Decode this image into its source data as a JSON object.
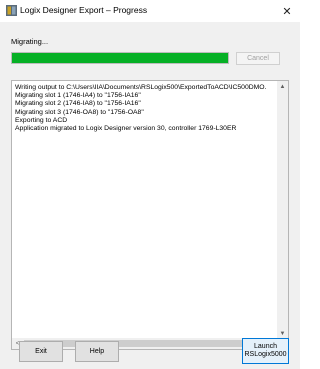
{
  "window": {
    "title": "Logix Designer Export – Progress",
    "close_glyph": "✕",
    "app_icon": "logix-designer-icon"
  },
  "status": {
    "text": "Migrating...",
    "progress_fraction": 1.0,
    "progress_color": "#06b025"
  },
  "buttons": {
    "cancel_label": "Cancel",
    "exit_label": "Exit",
    "help_label": "Help",
    "launch_label_line1": "Launch",
    "launch_label_line2": "RSLogix5000"
  },
  "log": {
    "lines": [
      "Writing output to C:\\Users\\IIA\\Documents\\RSLogix500\\ExportedToACD\\IC500DMO.",
      "Migrating slot 1 (1746-IA4) to \"1756-IA16\"",
      "Migrating slot 2 (1746-IA8) to \"1756-IA16\"",
      "Migrating slot 3 (1746-OA8) to \"1756-OA8\"",
      "Exporting to ACD",
      "Application migrated to Logix Designer version 30, controller 1769-L30ER"
    ]
  },
  "scrollbar": {
    "up": "▲",
    "down": "▼",
    "left": "<",
    "right": ">"
  }
}
